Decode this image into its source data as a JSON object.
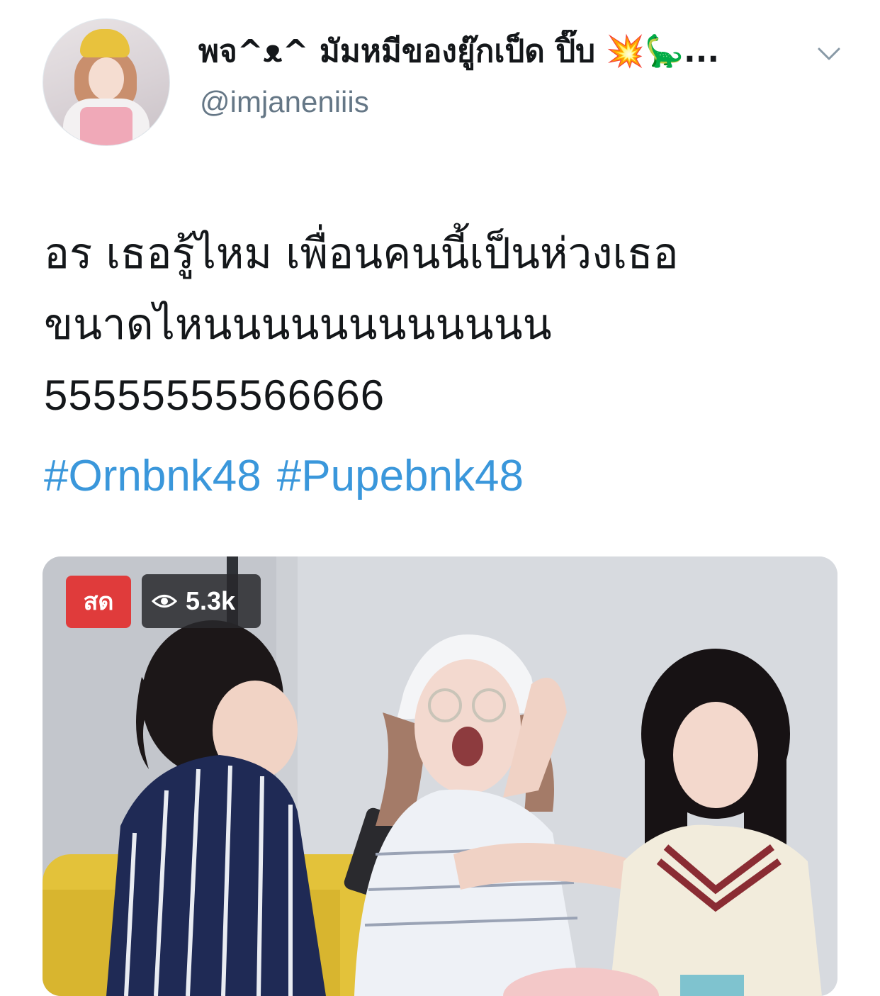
{
  "tweet": {
    "display_name": "พจ^ᴥ^ มัมหมีของยู๊กเป็ด ปิ๊บ 💥🦕...",
    "handle": "@imjaneniiis",
    "text_line1": "อร เธอรู้ไหม เพื่อนคนนี้เป็นห่วงเธอ",
    "text_line2": "ขนาดไหนนนนนนนนนนนน",
    "text_line3": "55555555566666",
    "hashtags": [
      "#Ornbnk48",
      "#Pupebnk48"
    ]
  },
  "media": {
    "live_label": "สด",
    "view_count": "5.3k",
    "icons": {
      "views": "eye-icon",
      "more": "chevron-down-icon"
    }
  },
  "colors": {
    "link": "#3a97db",
    "handle": "#657786",
    "live_badge": "#e03b3b"
  }
}
